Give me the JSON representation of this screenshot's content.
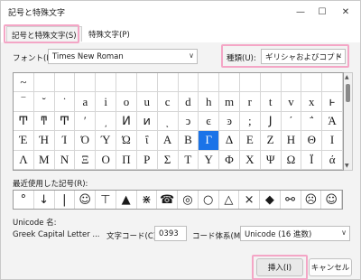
{
  "window": {
    "title": "記号と特殊文字",
    "minimize_glyph": "—",
    "maximize_glyph": "☐",
    "close_glyph": "✕"
  },
  "tabs": [
    {
      "label": "記号と特殊文字(S)",
      "active": true
    },
    {
      "label": "特殊文字(P)",
      "active": false
    }
  ],
  "font": {
    "label": "フォント(F):",
    "value": "Times New Roman"
  },
  "subset": {
    "label": "種類(U):",
    "value": "ギリシャおよびコプト"
  },
  "symbols": {
    "rows": [
      [
        "~",
        "",
        "",
        "",
        "",
        "",
        "",
        "",
        "",
        "",
        "",
        "",
        "",
        "",
        "",
        ""
      ],
      [
        "‾",
        "˘",
        "˙",
        "a",
        "i",
        "o",
        "u",
        "c",
        "d",
        "h",
        "m",
        "r",
        "t",
        "v",
        "x",
        "ͱ"
      ],
      [
        "Ͳ",
        "ͳ",
        "Ͳ̄",
        "ʹ",
        "͵",
        "Ͷ",
        "ͷ",
        "ͺ",
        "ͻ",
        "ͼ",
        "ͽ",
        ";",
        "Ϳ",
        "΄",
        "΅",
        "Ά"
      ],
      [
        "Έ",
        "Ή",
        "Ί",
        "Ό",
        "Ύ",
        "Ώ",
        "ΐ",
        "Α",
        "Β",
        "Γ",
        "Δ",
        "Ε",
        "Ζ",
        "Η",
        "Θ",
        "Ι"
      ],
      [
        "Λ",
        "Μ",
        "Ν",
        "Ξ",
        "Ο",
        "Π",
        "Ρ",
        "Σ",
        "Τ",
        "Υ",
        "Φ",
        "Χ",
        "Ψ",
        "Ω",
        "Ϊ",
        "ά"
      ]
    ],
    "selected_row": 3,
    "selected_col": 9
  },
  "recent": {
    "label": "最近使用した記号(R):",
    "items": [
      "°",
      "↓",
      "|",
      "☺",
      "⊤",
      "▲",
      "⋇",
      "☎",
      "◎",
      "○",
      "△",
      "×",
      "◆",
      "⚯",
      "☹",
      "☺"
    ]
  },
  "unicode": {
    "name_label": "Unicode 名:",
    "name_value": "Greek Capital Letter ...",
    "code_label": "文字コード(C):",
    "code_value": "0393",
    "system_label": "コード体系(M):",
    "system_value": "Unicode (16 進数)"
  },
  "buttons": {
    "insert": "挿入(I)",
    "cancel": "キャンセル"
  }
}
